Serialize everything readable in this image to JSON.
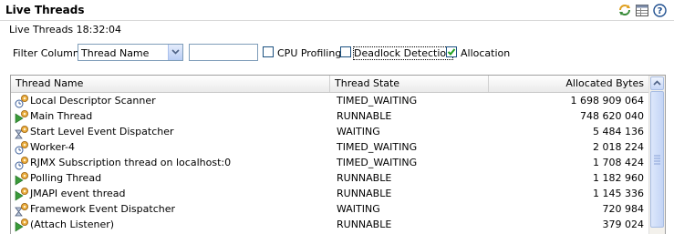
{
  "panel": {
    "title": "Live Threads",
    "subtitle": "Live Threads 18:32:04",
    "toolbar_icons": [
      "refresh-icon",
      "table-columns-icon",
      "help-icon"
    ]
  },
  "filter": {
    "label": "Filter Column",
    "column_select_value": "Thread Name",
    "text_value": "",
    "cpu_profiling": {
      "label": "CPU Profiling",
      "checked": false
    },
    "deadlock_detection": {
      "label": "Deadlock Detection",
      "checked": false
    },
    "allocation": {
      "label": "Allocation",
      "checked": true
    }
  },
  "table": {
    "columns": [
      "Thread Name",
      "Thread State",
      "Allocated Bytes"
    ],
    "rows": [
      {
        "name": "Local Descriptor Scanner",
        "state": "TIMED_WAITING",
        "bytes": "1 698 909 064",
        "icon": "thread-timed-waiting-icon"
      },
      {
        "name": "Main Thread",
        "state": "RUNNABLE",
        "bytes": "748 620 040",
        "icon": "thread-running-icon"
      },
      {
        "name": "Start Level Event Dispatcher",
        "state": "WAITING",
        "bytes": "5 484 136",
        "icon": "thread-waiting-icon"
      },
      {
        "name": "Worker-4",
        "state": "TIMED_WAITING",
        "bytes": "2 018 224",
        "icon": "thread-timed-waiting-icon"
      },
      {
        "name": "RJMX Subscription thread on localhost:0",
        "state": "TIMED_WAITING",
        "bytes": "1 708 424",
        "icon": "thread-timed-waiting-icon"
      },
      {
        "name": "Polling Thread",
        "state": "RUNNABLE",
        "bytes": "1 182 960",
        "icon": "thread-running-icon"
      },
      {
        "name": "JMAPI event thread",
        "state": "RUNNABLE",
        "bytes": "1 145 336",
        "icon": "thread-running-icon"
      },
      {
        "name": "Framework Event Dispatcher",
        "state": "WAITING",
        "bytes": "720 984",
        "icon": "thread-waiting-icon"
      },
      {
        "name": "(Attach Listener)",
        "state": "RUNNABLE",
        "bytes": "379 024",
        "icon": "thread-running-icon"
      }
    ]
  }
}
